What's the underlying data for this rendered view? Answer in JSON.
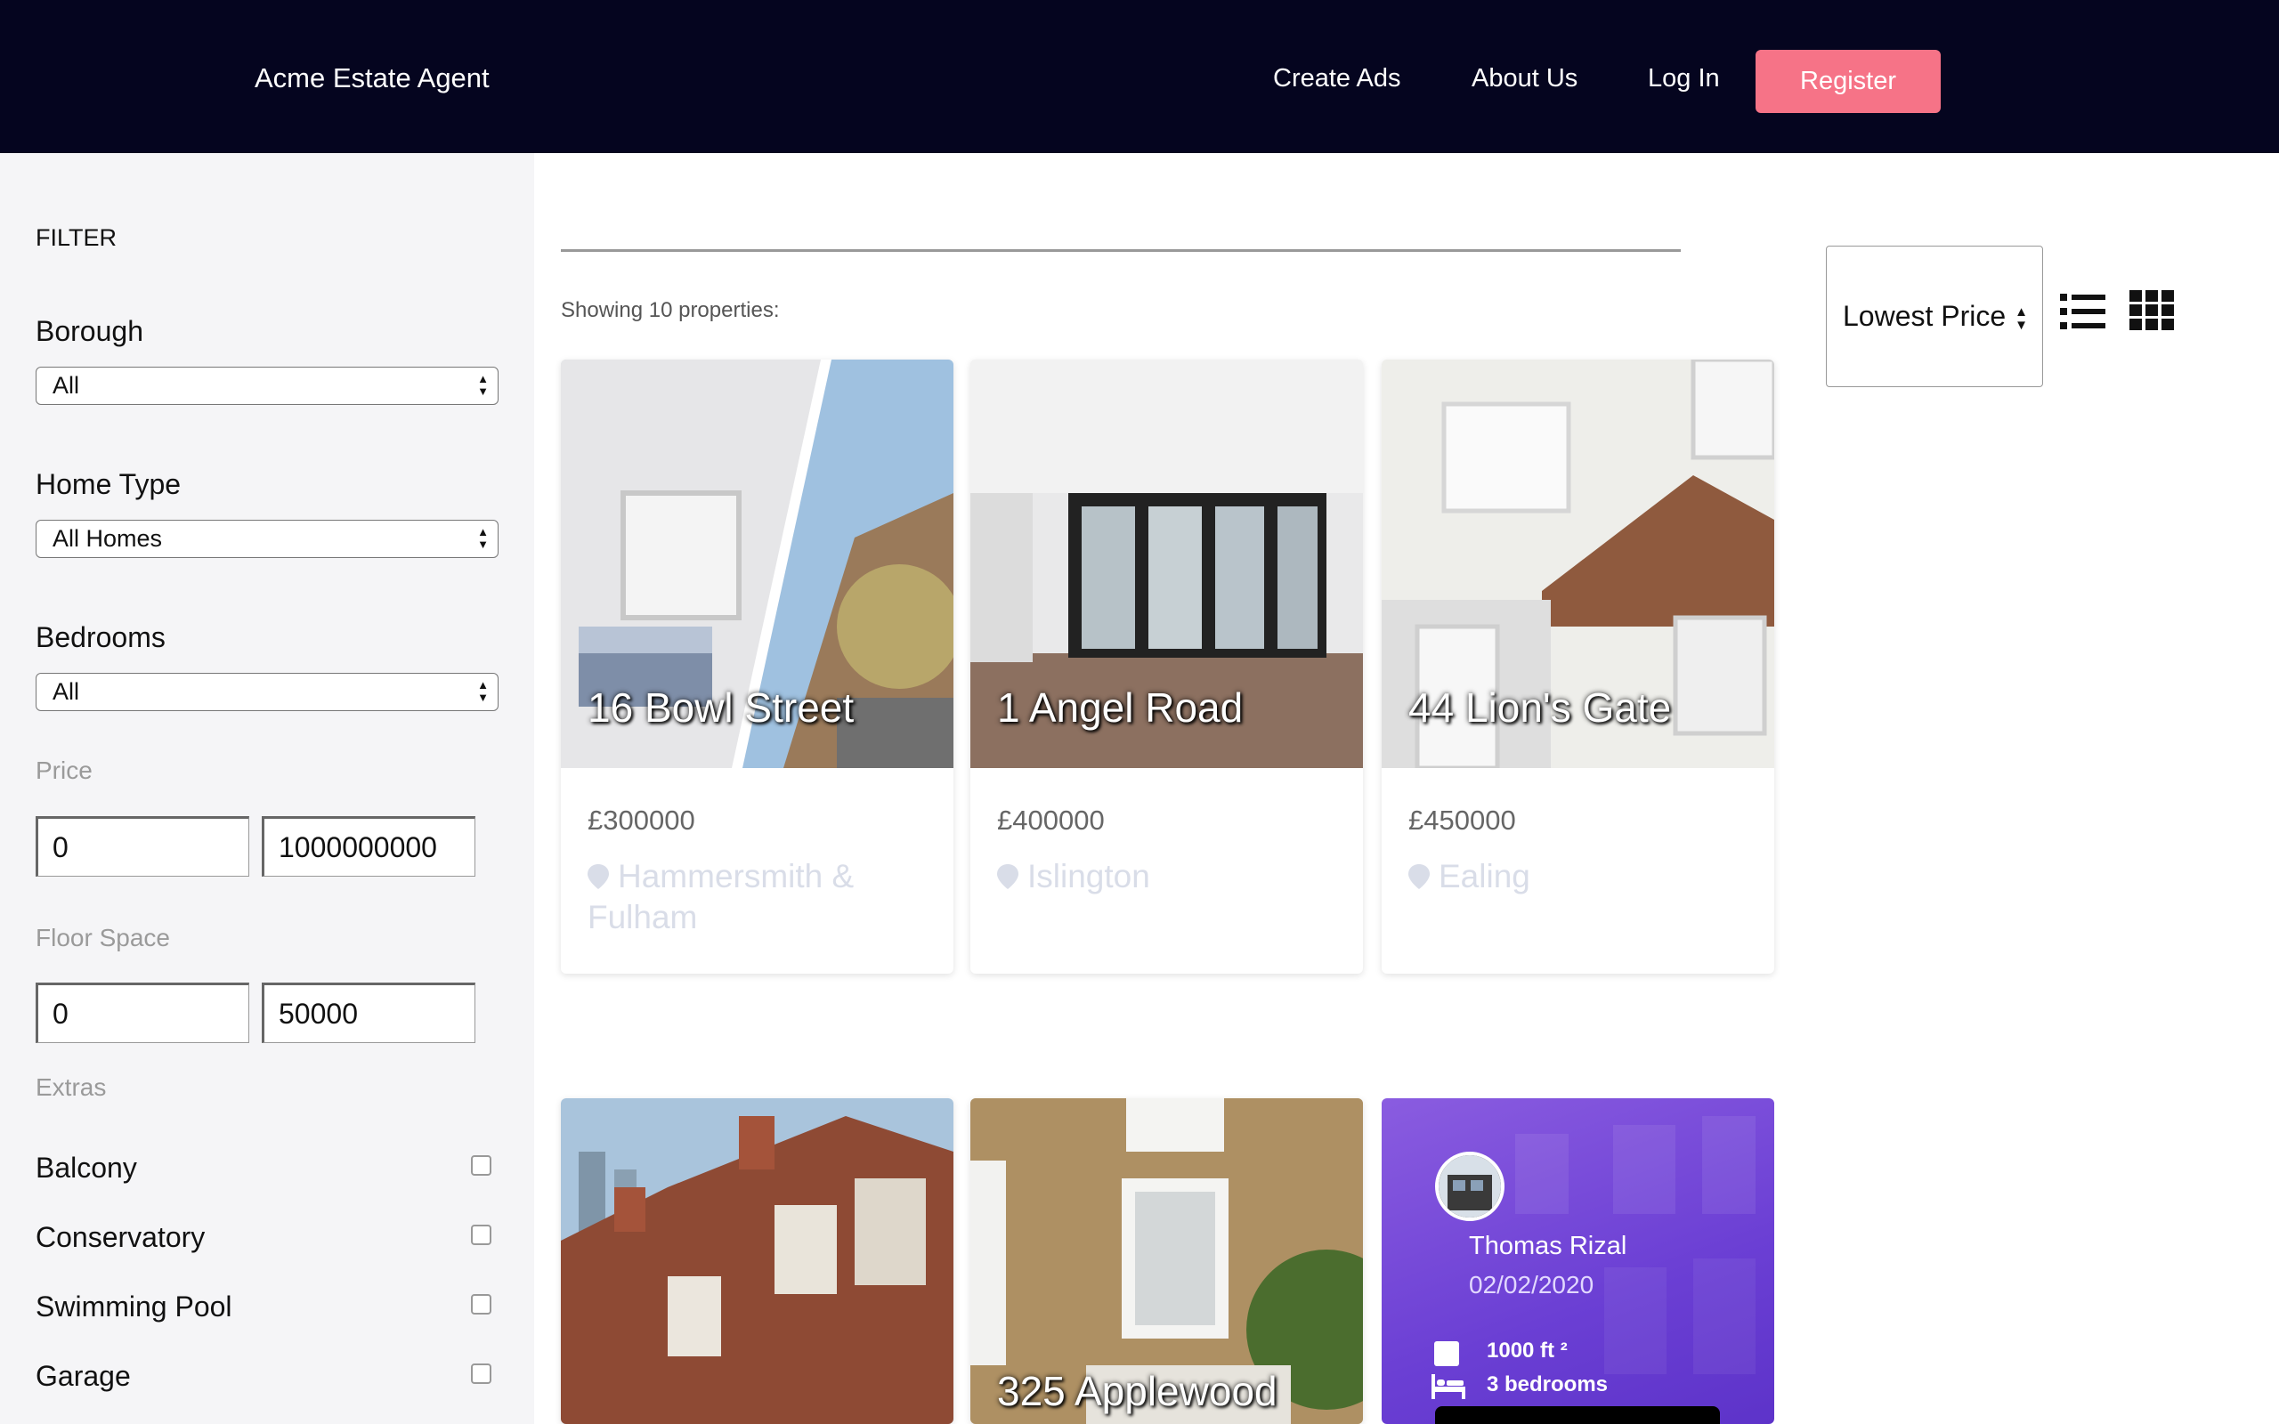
{
  "header": {
    "brand": "Acme Estate Agent",
    "nav": [
      "Create Ads",
      "About Us",
      "Log In"
    ],
    "register": "Register"
  },
  "filter": {
    "title": "FILTER",
    "borough_label": "Borough",
    "borough_value": "All",
    "home_type_label": "Home Type",
    "home_type_value": "All Homes",
    "bedrooms_label": "Bedrooms",
    "bedrooms_value": "All",
    "price_label": "Price",
    "price_min": "0",
    "price_max": "1000000000",
    "floor_label": "Floor Space",
    "floor_min": "0",
    "floor_max": "50000",
    "extras_label": "Extras",
    "extras": [
      "Balcony",
      "Conservatory",
      "Swimming Pool",
      "Garage"
    ]
  },
  "results": {
    "count_text": "Showing 10 properties:",
    "sort_value": "Lowest Price"
  },
  "cards": [
    {
      "title": "16 Bowl Street",
      "price": "£300000",
      "location": "Hammersmith & Fulham"
    },
    {
      "title": "1 Angel Road",
      "price": "£400000",
      "location": "Islington"
    },
    {
      "title": "44 Lion's Gate",
      "price": "£450000",
      "location": "Ealing"
    },
    {
      "title": ""
    },
    {
      "title": "325 Applewood"
    }
  ],
  "agent": {
    "name": "Thomas Rizal",
    "date": "02/02/2020",
    "area": "1000 ft ²",
    "bedrooms": "3 bedrooms"
  },
  "colors": {
    "header_bg": "#05051f",
    "register_bg": "#f67387",
    "agent_card": "#6b3fd4"
  }
}
